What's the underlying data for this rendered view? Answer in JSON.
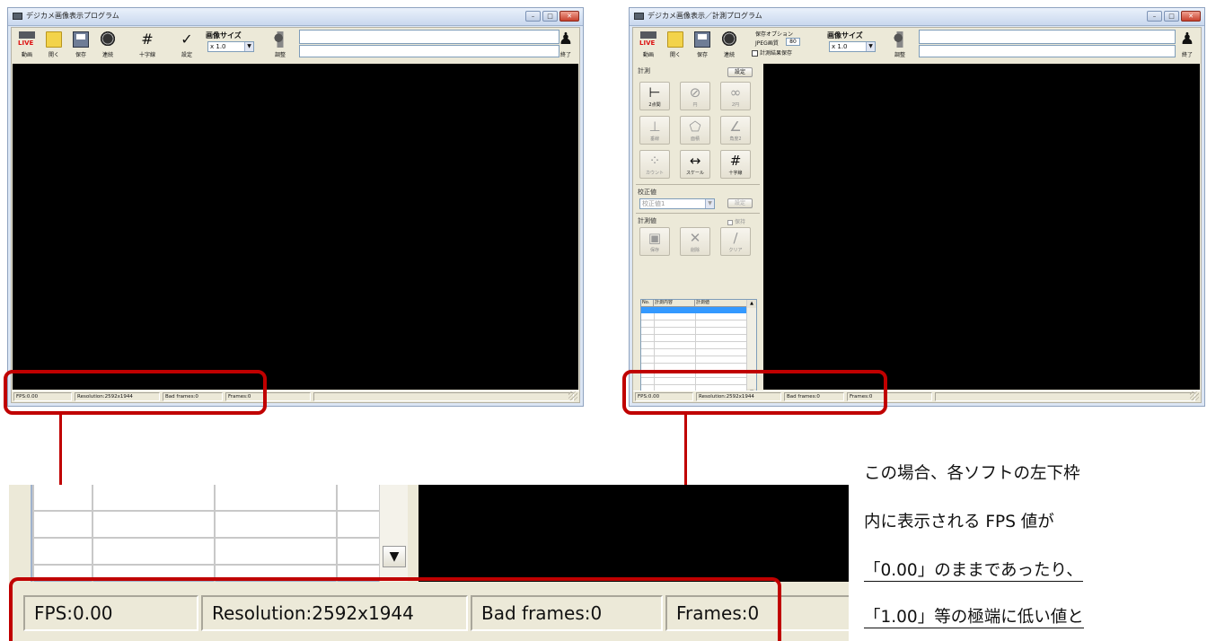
{
  "left_window": {
    "title": "デジカメ画像表示プログラム",
    "toolbar": [
      {
        "label": "動画",
        "icon": "live-camera-icon"
      },
      {
        "label": "開く",
        "icon": "folder-icon"
      },
      {
        "label": "保存",
        "icon": "floppy-disk-icon"
      },
      {
        "label": "連続",
        "icon": "continuous-capture-icon"
      },
      {
        "label": "十字線",
        "icon": "crosshair-grid-icon"
      },
      {
        "label": "設定",
        "icon": "checkmark-icon"
      }
    ],
    "image_size_label": "画像サイズ",
    "zoom_value": "x 1.0",
    "adjust_label": "調整",
    "status": {
      "fps": "FPS:0.00",
      "resolution": "Resolution:2592x1944",
      "bad_frames": "Bad frames:0",
      "frames": "Frames:0"
    }
  },
  "right_window": {
    "title": "デジカメ画像表示／計測プログラム",
    "toolbar": [
      {
        "label": "動画",
        "icon": "live-camera-icon"
      },
      {
        "label": "開く",
        "icon": "folder-icon"
      },
      {
        "label": "保存",
        "icon": "floppy-disk-icon"
      },
      {
        "label": "連続",
        "icon": "continuous-capture-icon"
      }
    ],
    "save_options": {
      "title": "保存オプション",
      "jpeg_label": "JPEG画質",
      "jpeg_value": "80",
      "save_result_label": "計測結果保存"
    },
    "image_size_label": "画像サイズ",
    "zoom_value": "x 1.0",
    "adjust_label": "調整",
    "exit_label": "終了",
    "measure_panel": {
      "title": "計測",
      "settings_button": "設定",
      "tools": [
        {
          "label": "2点間",
          "glyph": "⊢",
          "icon": "two-point-distance-icon"
        },
        {
          "label": "円",
          "glyph": "⊘",
          "icon": "circle-icon"
        },
        {
          "label": "2円",
          "glyph": "∞",
          "icon": "two-circle-icon"
        },
        {
          "label": "垂線",
          "glyph": "⊥",
          "icon": "perpendicular-icon"
        },
        {
          "label": "面積",
          "glyph": "⬠",
          "icon": "area-polygon-icon"
        },
        {
          "label": "角度2",
          "glyph": "∠",
          "icon": "angle-icon"
        },
        {
          "label": "カウント",
          "glyph": "⁘",
          "icon": "count-dots-icon"
        },
        {
          "label": "スケール",
          "glyph": "↔",
          "icon": "scale-icon"
        },
        {
          "label": "十字線",
          "glyph": "#",
          "icon": "crosshair-grid-icon"
        }
      ],
      "calibration_title": "校正値",
      "calibration_select": "校正値1",
      "calibration_button": "設定",
      "values_title": "計測値",
      "keep_label": "保持",
      "value_buttons": [
        {
          "label": "保存",
          "icon": "save-icon"
        },
        {
          "label": "削除",
          "icon": "delete-x-icon"
        },
        {
          "label": "クリア",
          "icon": "clear-icon"
        }
      ],
      "table_headers": [
        "No.",
        "計測内容",
        "計測値"
      ]
    },
    "status": {
      "fps": "FPS:0.00",
      "resolution": "Resolution:2592x1944",
      "bad_frames": "Bad frames:0",
      "frames": "Frames:0"
    }
  },
  "zoomed": {
    "fps": "FPS:0.00",
    "resolution": "Resolution:2592x1944",
    "bad_frames": "Bad frames:0",
    "frames": "Frames:0"
  },
  "note_lines": [
    "この場合、各ソフトの左下枠",
    "内に表示される ",
    "FPS 値が",
    "「0.00」のままであったり、",
    "「1.00」等の極端に低い値と"
  ],
  "colors": {
    "highlight": "#c00000",
    "view": "#000000",
    "selected_row": "#3399ff"
  }
}
